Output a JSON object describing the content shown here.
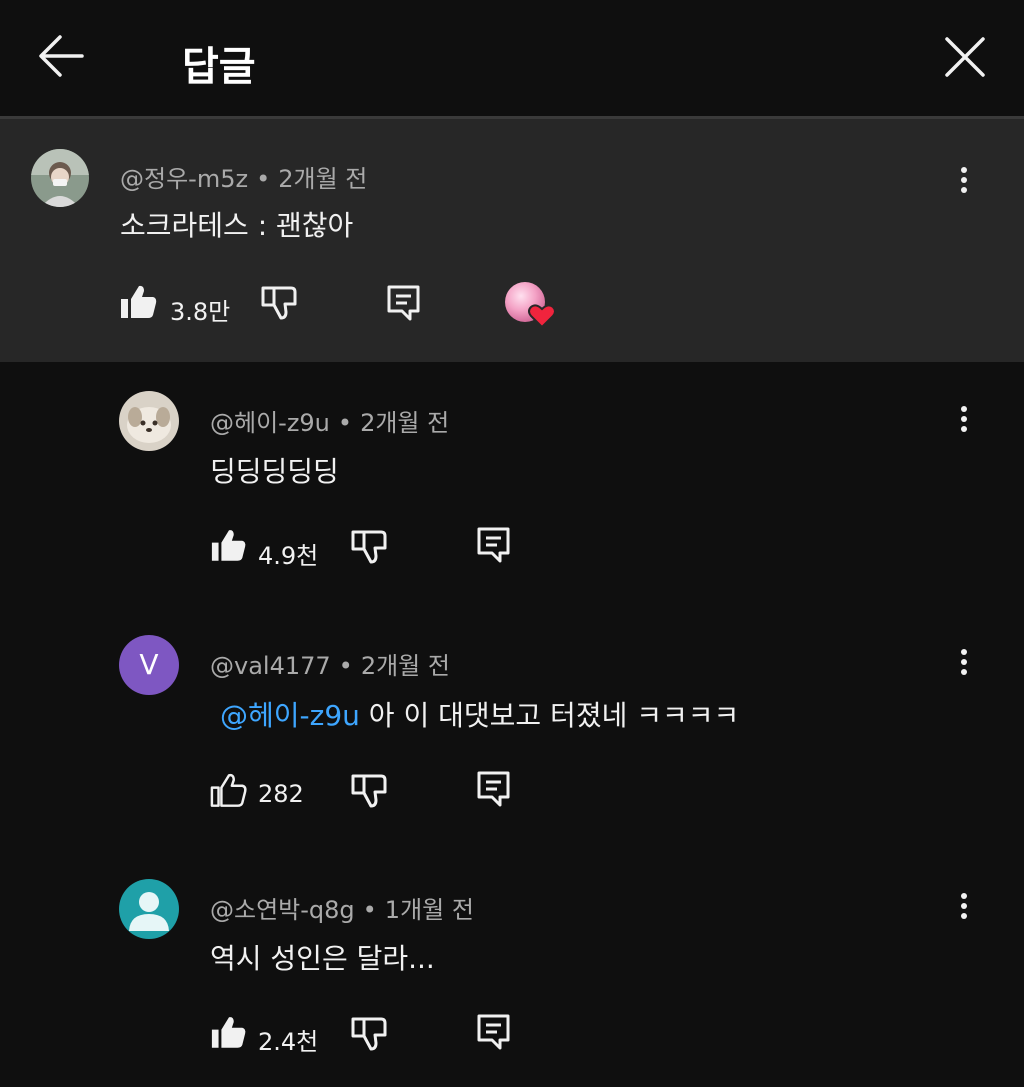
{
  "header": {
    "title": "답글"
  },
  "parent_comment": {
    "handle": "@정우-m5z",
    "time": "2개월 전",
    "text": "소크라테스 : 괜찮아",
    "likes": "3.8만",
    "creator_heart": true
  },
  "replies": [
    {
      "handle": "@헤이-z9u",
      "time": "2개월 전",
      "text": "딩딩딩딩딩",
      "likes": "4.9천",
      "liked": true
    },
    {
      "handle": "@val4177",
      "time": "2개월 전",
      "avatar_letter": "V",
      "mention": "@헤이-z9u",
      "text": " 아 이 대댓보고 터졌네 ㅋㅋㅋㅋ",
      "likes": "282",
      "liked": false
    },
    {
      "handle": "@소연박-q8g",
      "time": "1개월 전",
      "text": "역시 성인은 달라...",
      "likes": "2.4천",
      "liked": true
    }
  ],
  "meta_separator": "•",
  "colors": {
    "background": "#0f0f0f",
    "highlight": "#272727",
    "mention": "#3ea6ff",
    "avatar_v": "#7e57c2",
    "avatar_default": "#1fa0a8"
  }
}
